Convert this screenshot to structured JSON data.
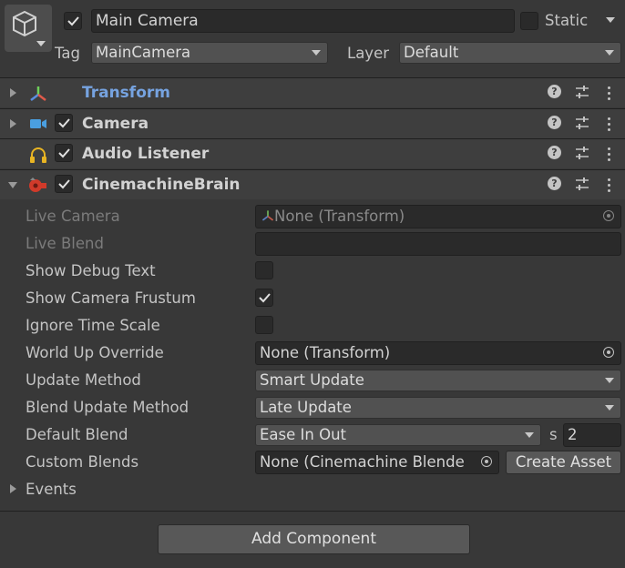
{
  "gameobject": {
    "name": "Main Camera",
    "static_label": "Static",
    "tag_label": "Tag",
    "tag_value": "MainCamera",
    "layer_label": "Layer",
    "layer_value": "Default"
  },
  "components": [
    {
      "name": "Transform",
      "icon": "transform-icon"
    },
    {
      "name": "Camera",
      "icon": "camera-icon"
    },
    {
      "name": "Audio Listener",
      "icon": "headphones-icon"
    },
    {
      "name": "CinemachineBrain",
      "icon": "cinemachine-icon"
    }
  ],
  "brain": {
    "live_camera_label": "Live Camera",
    "live_camera_value": "None (Transform)",
    "live_blend_label": "Live Blend",
    "show_debug_text_label": "Show Debug Text",
    "show_camera_frustum_label": "Show Camera Frustum",
    "ignore_time_scale_label": "Ignore Time Scale",
    "world_up_label": "World Up Override",
    "world_up_value": "None (Transform)",
    "update_method_label": "Update Method",
    "update_method_value": "Smart Update",
    "blend_update_label": "Blend Update Method",
    "blend_update_value": "Late Update",
    "default_blend_label": "Default Blend",
    "default_blend_value": "Ease In Out",
    "default_blend_unit": "s",
    "default_blend_time": "2",
    "custom_blends_label": "Custom Blends",
    "custom_blends_value": "None (Cinemachine Blende",
    "create_asset_label": "Create Asset",
    "events_label": "Events"
  },
  "add_component_label": "Add Component",
  "colors": {
    "transform_title": "#76a3e0",
    "panel": "#383838",
    "header": "#3e3e3e"
  }
}
